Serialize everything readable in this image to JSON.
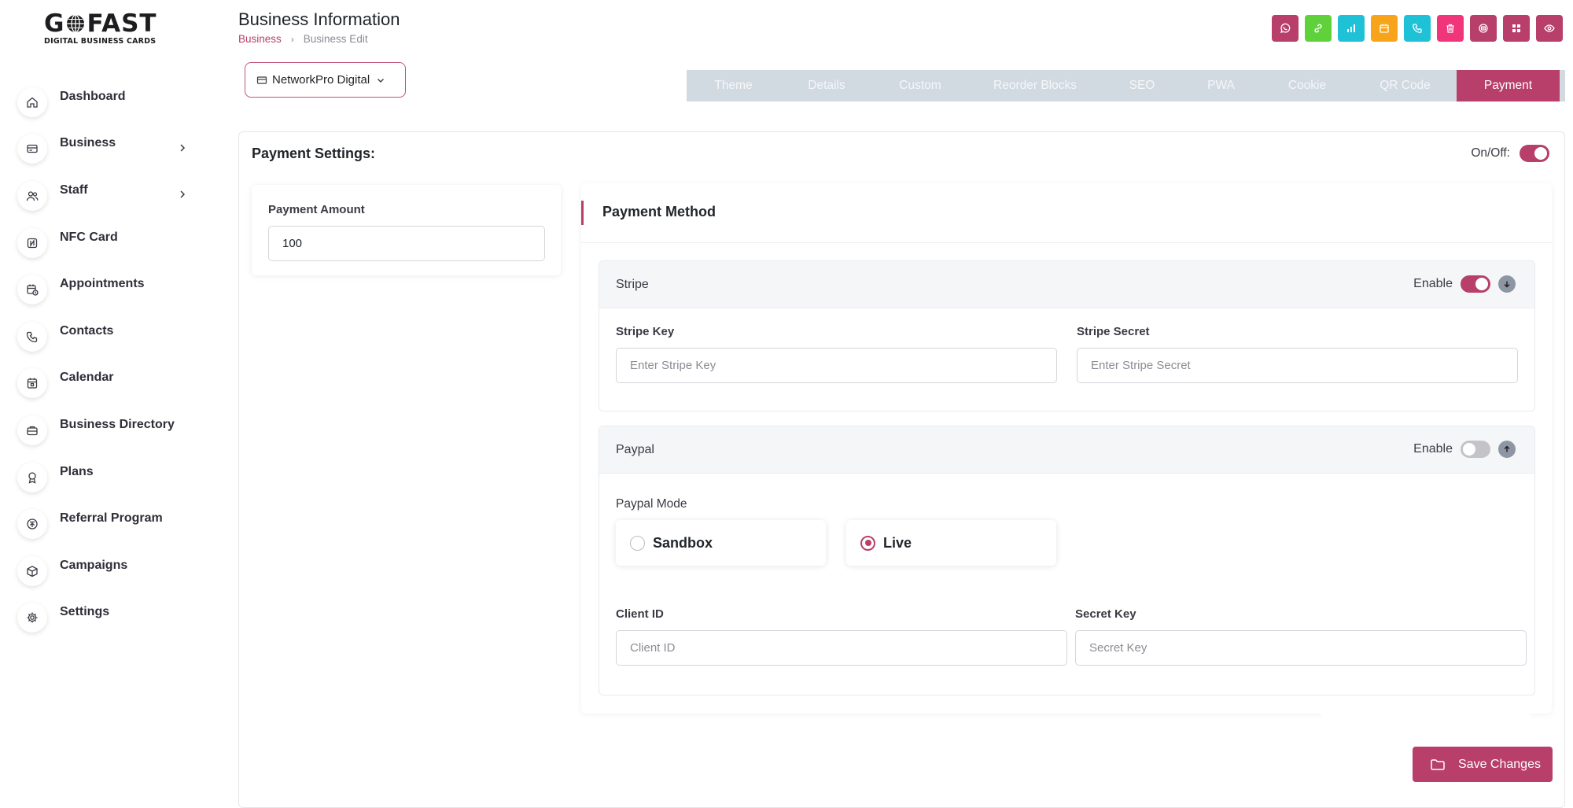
{
  "brand": {
    "logo_main_left": "G",
    "logo_main_right": "FAST",
    "logo_sub": "DIGITAL BUSINESS CARDS"
  },
  "sidebar": {
    "items": [
      {
        "label": "Dashboard",
        "icon": "home-icon"
      },
      {
        "label": "Business",
        "icon": "card-icon",
        "chevron": true
      },
      {
        "label": "Staff",
        "icon": "users-icon",
        "chevron": true
      },
      {
        "label": "NFC Card",
        "icon": "nfc-icon"
      },
      {
        "label": "Appointments",
        "icon": "calendar-clock-icon"
      },
      {
        "label": "Contacts",
        "icon": "phone-icon"
      },
      {
        "label": "Calendar",
        "icon": "calendar-icon"
      },
      {
        "label": "Business Directory",
        "icon": "briefcase-icon"
      },
      {
        "label": "Plans",
        "icon": "award-icon"
      },
      {
        "label": "Referral Program",
        "icon": "referral-icon"
      },
      {
        "label": "Campaigns",
        "icon": "box-icon"
      },
      {
        "label": "Settings",
        "icon": "gear-icon"
      }
    ]
  },
  "header": {
    "title": "Business Information",
    "breadcrumb": {
      "parent": "Business",
      "separator": "›",
      "current": "Business Edit"
    },
    "actions": [
      {
        "name": "whatsapp-icon",
        "color": "#b73f6a"
      },
      {
        "name": "link-icon",
        "color": "#5fd13b"
      },
      {
        "name": "analytics-icon",
        "color": "#1fc1d6"
      },
      {
        "name": "calendar-icon",
        "color": "#f8a41b"
      },
      {
        "name": "phone-icon",
        "color": "#1fc1d6"
      },
      {
        "name": "trash-icon",
        "color": "#f0357a"
      },
      {
        "name": "printer-icon",
        "color": "#b73f6a"
      },
      {
        "name": "grid-icon",
        "color": "#b73f6a"
      },
      {
        "name": "eye-icon",
        "color": "#b73f6a"
      }
    ]
  },
  "business_select": {
    "value": "NetworkPro Digital"
  },
  "tabs": [
    {
      "label": "Theme"
    },
    {
      "label": "Details"
    },
    {
      "label": "Custom"
    },
    {
      "label": "Reorder Blocks"
    },
    {
      "label": "SEO"
    },
    {
      "label": "PWA"
    },
    {
      "label": "Cookie"
    },
    {
      "label": "QR Code"
    },
    {
      "label": "Payment",
      "active": true
    }
  ],
  "payment": {
    "title": "Payment Settings:",
    "onoff_label": "On/Off:",
    "onoff_state": "on",
    "amount_label": "Payment Amount",
    "amount_value": "100",
    "method_title": "Payment Method",
    "stripe": {
      "name": "Stripe",
      "enable_label": "Enable",
      "enabled": true,
      "key_label": "Stripe Key",
      "key_placeholder": "Enter Stripe Key",
      "secret_label": "Stripe Secret",
      "secret_placeholder": "Enter Stripe Secret"
    },
    "paypal": {
      "name": "Paypal",
      "enable_label": "Enable",
      "enabled": false,
      "mode_label": "Paypal Mode",
      "modes": [
        {
          "label": "Sandbox",
          "checked": false
        },
        {
          "label": "Live",
          "checked": true
        }
      ],
      "client_label": "Client ID",
      "client_placeholder": "Client ID",
      "secret_label": "Secret Key",
      "secret_placeholder": "Secret Key"
    }
  },
  "save_label": "Save Changes",
  "colors": {
    "accent": "#b73f6a",
    "tab_bar": "#d2dae1"
  }
}
